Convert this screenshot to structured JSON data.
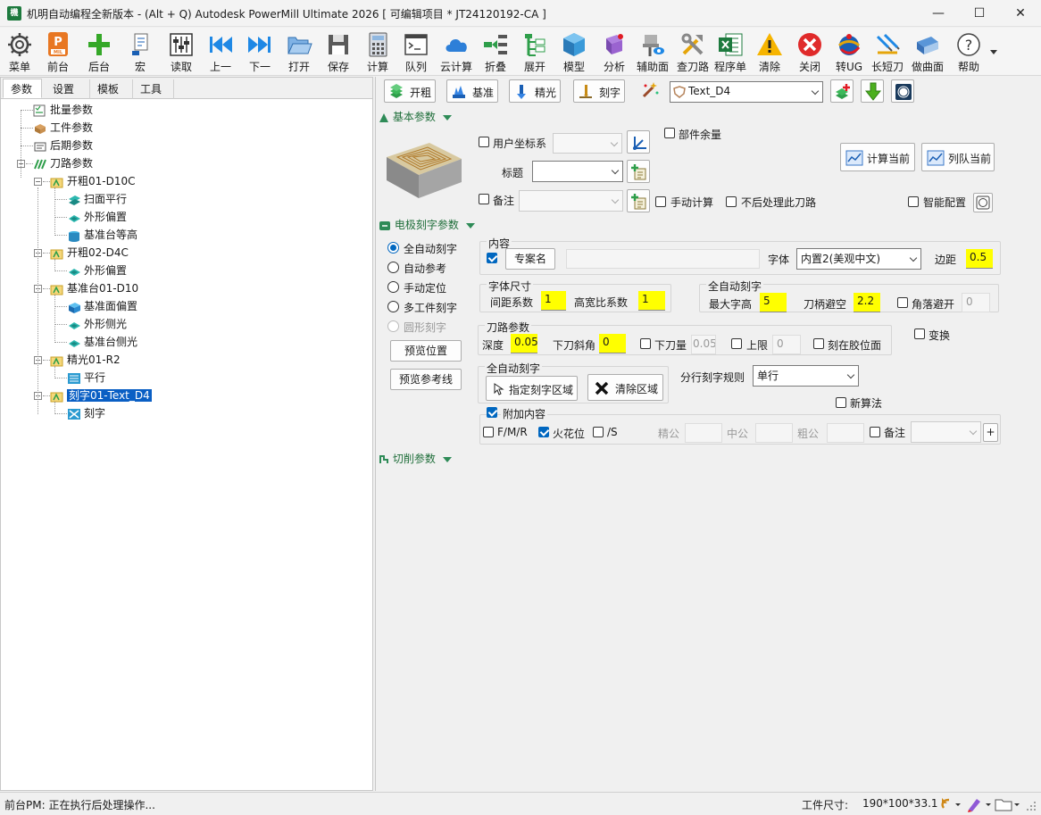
{
  "window": {
    "app_icon": "excel-style-app-icon",
    "title": "机明自动编程全新版本 - (Alt + Q) Autodesk PowerMill Ultimate 2026    [ 可编辑项目 * JT24120192-CA ]",
    "minimize": "—",
    "maximize": "☐",
    "close": "✕"
  },
  "toolbar": [
    {
      "label": "菜单",
      "icon": "gear-icon"
    },
    {
      "label": "前台",
      "icon": "pm-mil-icon"
    },
    {
      "label": "后台",
      "icon": "plus-icon"
    },
    {
      "label": "宏",
      "icon": "macro-icon"
    },
    {
      "label": "读取",
      "icon": "sliders-icon"
    },
    {
      "label": "上一",
      "icon": "prev-icon"
    },
    {
      "label": "下一",
      "icon": "next-icon"
    },
    {
      "label": "打开",
      "icon": "folder-open-icon"
    },
    {
      "label": "保存",
      "icon": "save-icon"
    },
    {
      "label": "计算",
      "icon": "calculator-icon"
    },
    {
      "label": "队列",
      "icon": "terminal-icon"
    },
    {
      "label": "云计算",
      "icon": "cloud-icon"
    },
    {
      "label": "折叠",
      "icon": "collapse-icon"
    },
    {
      "label": "展开",
      "icon": "expand-icon"
    },
    {
      "label": "模型",
      "icon": "cube-icon"
    },
    {
      "label": "分析",
      "icon": "analysis-icon"
    },
    {
      "label": "辅助面",
      "icon": "aux-surface-icon"
    },
    {
      "label": "查刀路",
      "icon": "tools-icon"
    },
    {
      "label": "程序单",
      "icon": "excel-icon"
    },
    {
      "label": "清除",
      "icon": "warning-icon"
    },
    {
      "label": "关闭",
      "icon": "close-circle-icon"
    },
    {
      "label": "转UG",
      "icon": "ug-icon"
    },
    {
      "label": "长短刀",
      "icon": "long-short-tool-icon"
    },
    {
      "label": "做曲面",
      "icon": "surface-icon"
    },
    {
      "label": "帮助",
      "icon": "help-icon"
    }
  ],
  "left_tabs": [
    "参数",
    "设置",
    "模板",
    "工具"
  ],
  "tree": [
    {
      "label": "批量参数",
      "icon": "batch-icon"
    },
    {
      "label": "工件参数",
      "icon": "workpiece-icon"
    },
    {
      "label": "后期参数",
      "icon": "post-icon"
    },
    {
      "label": "刀路参数",
      "icon": "toolpath-group-icon"
    },
    {
      "label": "开粗01-D10C",
      "icon": "folder-toolpath-icon"
    },
    {
      "label": "扫面平行",
      "icon": "raster-icon"
    },
    {
      "label": "外形偏置",
      "icon": "offset-icon"
    },
    {
      "label": "基准台等高",
      "icon": "constant-z-icon"
    },
    {
      "label": "开粗02-D4C",
      "icon": "folder-toolpath-icon"
    },
    {
      "label": "外形偏置",
      "icon": "offset-icon"
    },
    {
      "label": "基准台01-D10",
      "icon": "folder-toolpath-icon"
    },
    {
      "label": "基准面偏置",
      "icon": "plane-offset-icon"
    },
    {
      "label": "外形侧光",
      "icon": "offset-icon"
    },
    {
      "label": "基准台侧光",
      "icon": "offset-icon"
    },
    {
      "label": "精光01-R2",
      "icon": "folder-toolpath-icon"
    },
    {
      "label": "平行",
      "icon": "parallel-icon"
    },
    {
      "label": "刻字01-Text_D4",
      "icon": "folder-toolpath-icon"
    },
    {
      "label": "刻字",
      "icon": "engrave-icon"
    }
  ],
  "top_buttons": {
    "rough": "开粗",
    "base": "基准",
    "finish": "精光",
    "engrave": "刻字"
  },
  "template_combo": "Text_D4",
  "sections": {
    "basic": "基本参数",
    "electrode": "电极刻字参数",
    "cut": "切削参数"
  },
  "basic": {
    "user_cs": "用户坐标系",
    "part_allowance": "部件余量",
    "title_label": "标题",
    "title_value": "",
    "remark_label": "备注",
    "manual_calc": "手动计算",
    "no_post": "不后处理此刀路",
    "smart_config": "智能配置",
    "calc_current": "计算当前",
    "queue_current": "列队当前"
  },
  "modes": [
    "全自动刻字",
    "自动参考",
    "手动定位",
    "多工件刻字",
    "圆形刻字"
  ],
  "preview_pos": "预览位置",
  "preview_ref": "预览参考线",
  "content": {
    "group": "内容",
    "case_name_btn": "专案名",
    "font_label": "字体",
    "font_value": "内置2(美观中文)",
    "margin_label": "边距",
    "margin_value": "0.5"
  },
  "font_size": {
    "group": "字体尺寸",
    "spacing_label": "间距系数",
    "spacing_value": "1",
    "ratio_label": "高宽比系数",
    "ratio_value": "1"
  },
  "auto_engrave": {
    "group": "全自动刻字",
    "max_h_label": "最大字高",
    "max_h_value": "5",
    "holder_label": "刀柄避空",
    "holder_value": "2.2",
    "corner_label": "角落避开",
    "corner_value": "0"
  },
  "toolpath": {
    "group": "刀路参数",
    "depth_label": "深度",
    "depth_value": "0.05",
    "ramp_label": "下刀斜角",
    "ramp_value": "0",
    "stepdown_label": "下刀量",
    "stepdown_value": "0.05",
    "upper_label": "上限",
    "upper_value": "0",
    "glue_label": "刻在胶位面",
    "transform_label": "变换"
  },
  "auto_area": {
    "group": "全自动刻字",
    "assign_btn": "指定刻字区域",
    "clear_btn": "清除区域",
    "line_rule_label": "分行刻字规则",
    "line_rule_value": "单行",
    "new_algo": "新算法"
  },
  "extra": {
    "group": "附加内容",
    "fmr": "F/M/R",
    "spark": "火花位",
    "s": "/S",
    "fine": "精公",
    "mid": "中公",
    "rough": "粗公",
    "remark": "备注",
    "plus": "+"
  },
  "status": {
    "left": "前台PM: 正在执行后处理操作...",
    "size_label": "工件尺寸:",
    "size_value": "190*100*33.1"
  },
  "colors": {
    "accent": "#0067c0",
    "highlight": "#ffff00",
    "section": "#1f6e3a"
  }
}
